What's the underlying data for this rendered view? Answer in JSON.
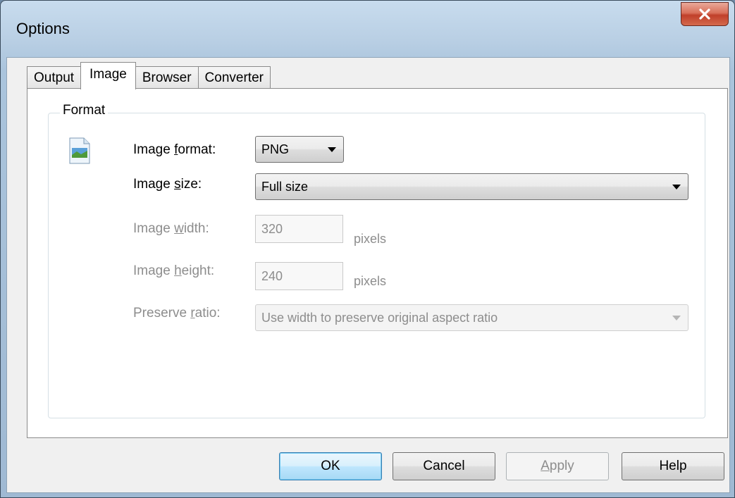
{
  "window": {
    "title": "Options",
    "close_icon": "close-icon"
  },
  "tabs": [
    {
      "label": "Output",
      "active": false
    },
    {
      "label": "Image",
      "active": true
    },
    {
      "label": "Browser",
      "active": false
    },
    {
      "label": "Converter",
      "active": false
    }
  ],
  "format_group": {
    "label": "Format",
    "icon": "image-file-icon",
    "image_format": {
      "label_pre": "Image ",
      "label_key": "f",
      "label_post": "ormat:",
      "value": "PNG"
    },
    "image_size": {
      "label_pre": "Image ",
      "label_key": "s",
      "label_post": "ize:",
      "value": "Full size"
    },
    "image_width": {
      "label_pre": "Image ",
      "label_key": "w",
      "label_post": "idth:",
      "value": "320",
      "unit": "pixels"
    },
    "image_height": {
      "label_pre": "Image ",
      "label_key": "h",
      "label_post": "eight:",
      "value": "240",
      "unit": "pixels"
    },
    "preserve_ratio": {
      "label_pre": "Preserve ",
      "label_key": "r",
      "label_post": "atio:",
      "value": "Use width to preserve original aspect ratio"
    }
  },
  "buttons": {
    "ok": "OK",
    "cancel": "Cancel",
    "apply_key": "A",
    "apply_rest": "pply",
    "help": "Help"
  }
}
